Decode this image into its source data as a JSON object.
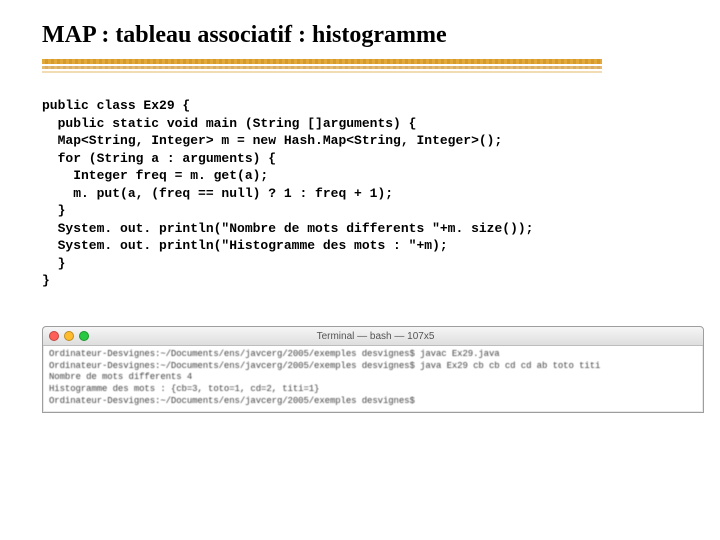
{
  "title": "MAP : tableau associatif : histogramme",
  "code": {
    "l0": "public class Ex29 {",
    "l1": "  public static void main (String []arguments) {",
    "l2": "  Map<String, Integer> m = new Hash.Map<String, Integer>();",
    "l3": "  for (String a : arguments) {",
    "l4": "    Integer freq = m. get(a);",
    "l5": "    m. put(a, (freq == null) ? 1 : freq + 1);",
    "l6": "  }",
    "l7": "  System. out. println(\"Nombre de mots differents \"+m. size());",
    "l8": "  System. out. println(\"Histogramme des mots : \"+m);",
    "l9": "  }",
    "l10": "}"
  },
  "terminal": {
    "title": "Terminal — bash — 107x5",
    "lines": {
      "t0": "Ordinateur-Desvignes:~/Documents/ens/javcerg/2005/exemples desvignes$ javac Ex29.java",
      "t1": "Ordinateur-Desvignes:~/Documents/ens/javcerg/2005/exemples desvignes$ java Ex29 cb cb cd cd ab toto titi",
      "t2": "Nombre de mots differents 4",
      "t3": "Histogramme des mots : {cb=3, toto=1, cd=2, titi=1}",
      "t4": "Ordinateur-Desvignes:~/Documents/ens/javcerg/2005/exemples desvignes$"
    }
  }
}
